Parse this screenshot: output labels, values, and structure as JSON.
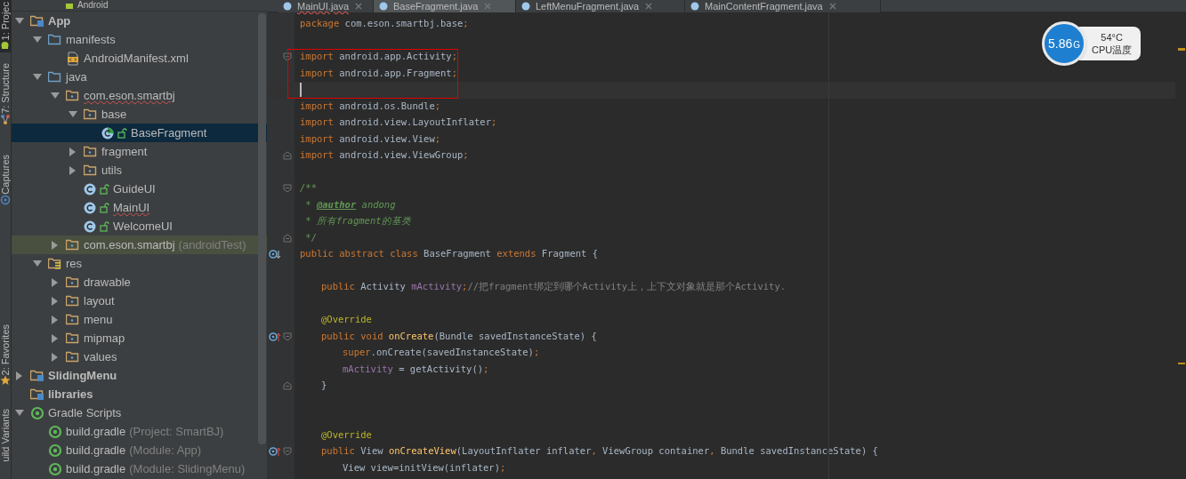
{
  "tool_strip": [
    {
      "label": "1: Projec",
      "selected": true
    },
    {
      "label": "7: Structure",
      "selected": false
    },
    {
      "label": "Captures",
      "selected": false
    },
    {
      "label": "2: Favorites",
      "selected": false
    },
    {
      "label": "uild Variants",
      "selected": false
    }
  ],
  "project_panel": {
    "view": "Android",
    "tree": [
      {
        "label": "App",
        "kind": "module",
        "expanded": true,
        "children": [
          {
            "label": "manifests",
            "kind": "folder",
            "expanded": true,
            "children": [
              {
                "label": "AndroidManifest.xml",
                "kind": "xml"
              }
            ]
          },
          {
            "label": "java",
            "kind": "folder",
            "expanded": true,
            "children": [
              {
                "label": "com.eson.smartbj",
                "kind": "package",
                "expanded": true,
                "error": true,
                "children": [
                  {
                    "label": "base",
                    "kind": "package",
                    "expanded": true,
                    "children": [
                      {
                        "label": "BaseFragment",
                        "kind": "abstract-class",
                        "selected": true
                      }
                    ]
                  },
                  {
                    "label": "fragment",
                    "kind": "package",
                    "expanded": false
                  },
                  {
                    "label": "utils",
                    "kind": "package",
                    "expanded": false
                  },
                  {
                    "label": "GuideUI",
                    "kind": "class"
                  },
                  {
                    "label": "MainUI",
                    "kind": "class",
                    "error": true
                  },
                  {
                    "label": "WelcomeUI",
                    "kind": "class"
                  }
                ]
              },
              {
                "label": "com.eson.smartbj",
                "suffix": "(androidTest)",
                "kind": "package",
                "expanded": false,
                "highlighted": true
              }
            ]
          },
          {
            "label": "res",
            "kind": "res",
            "expanded": true,
            "children": [
              {
                "label": "drawable",
                "kind": "package",
                "expanded": false
              },
              {
                "label": "layout",
                "kind": "package",
                "expanded": false
              },
              {
                "label": "menu",
                "kind": "package",
                "expanded": false
              },
              {
                "label": "mipmap",
                "kind": "package",
                "expanded": false
              },
              {
                "label": "values",
                "kind": "package",
                "expanded": false
              }
            ]
          }
        ]
      },
      {
        "label": "SlidingMenu",
        "kind": "module",
        "expanded": false
      },
      {
        "label": "libraries",
        "kind": "module"
      },
      {
        "label": "Gradle Scripts",
        "kind": "gradle",
        "expanded": true,
        "children": [
          {
            "label": "build.gradle",
            "suffix": "(Project: SmartBJ)",
            "kind": "gradle"
          },
          {
            "label": "build.gradle",
            "suffix": "(Module: App)",
            "kind": "gradle"
          },
          {
            "label": "build.gradle",
            "suffix": "(Module: SlidingMenu)",
            "kind": "gradle"
          }
        ]
      }
    ]
  },
  "editor_tabs": [
    {
      "label": "MainUI.java",
      "selected": false,
      "error": true
    },
    {
      "label": "BaseFragment.java",
      "selected": true,
      "error": false
    },
    {
      "label": "LeftMenuFragment.java",
      "selected": false,
      "error": false
    },
    {
      "label": "MainContentFragment.java",
      "selected": false,
      "error": false
    }
  ],
  "code_lines": [
    {
      "tokens": [
        {
          "kind": "keyword",
          "text": "package "
        },
        {
          "kind": "plain",
          "text": "com.eson.smartbj.base"
        },
        {
          "kind": "keyword",
          "text": ";"
        }
      ]
    },
    {
      "kind": "blank"
    },
    {
      "fold_open": true,
      "boxed": true,
      "tokens": [
        {
          "kind": "keyword",
          "text": "import "
        },
        {
          "kind": "plain",
          "text": "android.app.Activity"
        },
        {
          "kind": "keyword",
          "text": ";"
        }
      ]
    },
    {
      "boxed": true,
      "tokens": [
        {
          "kind": "keyword",
          "text": "import "
        },
        {
          "kind": "plain",
          "text": "android.app.Fragment"
        },
        {
          "kind": "keyword",
          "text": ";"
        }
      ]
    },
    {
      "kind": "blank",
      "boxed": true,
      "caret": true
    },
    {
      "tokens": [
        {
          "kind": "keyword",
          "text": "import "
        },
        {
          "kind": "plain",
          "text": "android.os.Bundle"
        },
        {
          "kind": "keyword",
          "text": ";"
        }
      ]
    },
    {
      "tokens": [
        {
          "kind": "keyword",
          "text": "import "
        },
        {
          "kind": "plain",
          "text": "android.view.LayoutInflater"
        },
        {
          "kind": "keyword",
          "text": ";"
        }
      ]
    },
    {
      "tokens": [
        {
          "kind": "keyword",
          "text": "import "
        },
        {
          "kind": "plain",
          "text": "android.view.View"
        },
        {
          "kind": "keyword",
          "text": ";"
        }
      ]
    },
    {
      "fold_close": true,
      "tokens": [
        {
          "kind": "keyword",
          "text": "import "
        },
        {
          "kind": "plain",
          "text": "android.view.ViewGroup"
        },
        {
          "kind": "keyword",
          "text": ";"
        }
      ]
    },
    {
      "kind": "blank"
    },
    {
      "fold_open": true,
      "tokens": [
        {
          "kind": "doc",
          "text": "/**"
        }
      ]
    },
    {
      "tokens": [
        {
          "kind": "doc",
          "text": " * "
        },
        {
          "kind": "doctag",
          "text": "@author"
        },
        {
          "kind": "doc",
          "text": " andong"
        }
      ]
    },
    {
      "tokens": [
        {
          "kind": "doc",
          "text": " * 所有fragment的基类"
        }
      ]
    },
    {
      "fold_close": true,
      "tokens": [
        {
          "kind": "doc",
          "text": " */"
        }
      ]
    },
    {
      "implemented_marker": true,
      "tokens": [
        {
          "kind": "keyword",
          "text": "public abstract class "
        },
        {
          "kind": "plain",
          "text": "BaseFragment "
        },
        {
          "kind": "keyword",
          "text": "extends "
        },
        {
          "kind": "plain",
          "text": "Fragment {"
        }
      ],
      "children": [
        {
          "kind": "blank"
        },
        {
          "tokens": [
            {
              "kind": "keyword",
              "text": "public "
            },
            {
              "kind": "plain",
              "text": "Activity "
            },
            {
              "kind": "field",
              "text": "mActivity"
            },
            {
              "kind": "keyword",
              "text": ";"
            },
            {
              "kind": "comment",
              "text": "//把fragment绑定到哪个Activity上，上下文对象就是那个Activity."
            }
          ]
        },
        {
          "kind": "blank"
        },
        {
          "tokens": [
            {
              "kind": "annotation",
              "text": "@Override"
            }
          ]
        },
        {
          "override_marker": true,
          "fold_open": true,
          "tokens": [
            {
              "kind": "keyword",
              "text": "public void "
            },
            {
              "kind": "method",
              "text": "onCreate"
            },
            {
              "kind": "plain",
              "text": "(Bundle savedInstanceState) {"
            }
          ],
          "children": [
            {
              "tokens": [
                {
                  "kind": "keyword",
                  "text": "super"
                },
                {
                  "kind": "plain",
                  "text": ".onCreate(savedInstanceState)"
                },
                {
                  "kind": "keyword",
                  "text": ";"
                }
              ]
            },
            {
              "tokens": [
                {
                  "kind": "field",
                  "text": "mActivity"
                },
                {
                  "kind": "plain",
                  "text": " = getActivity()"
                },
                {
                  "kind": "keyword",
                  "text": ";"
                }
              ]
            }
          ]
        },
        {
          "fold_close": true,
          "tokens": [
            {
              "kind": "plain",
              "text": "}"
            }
          ]
        },
        {
          "kind": "blank"
        },
        {
          "kind": "blank"
        },
        {
          "tokens": [
            {
              "kind": "annotation",
              "text": "@Override"
            }
          ]
        },
        {
          "override_marker": true,
          "fold_open": true,
          "tokens": [
            {
              "kind": "keyword",
              "text": "public "
            },
            {
              "kind": "plain",
              "text": "View "
            },
            {
              "kind": "method",
              "text": "onCreateView"
            },
            {
              "kind": "plain",
              "text": "(LayoutInflater inflater"
            },
            {
              "kind": "keyword",
              "text": ", "
            },
            {
              "kind": "plain",
              "text": "ViewGroup container"
            },
            {
              "kind": "keyword",
              "text": ", "
            },
            {
              "kind": "plain",
              "text": "Bundle savedInstanceState) {"
            }
          ],
          "children": [
            {
              "tokens": [
                {
                  "kind": "plain",
                  "text": "View view=initView(inflater)"
                },
                {
                  "kind": "keyword",
                  "text": ";"
                }
              ]
            }
          ]
        }
      ]
    }
  ],
  "cpu_widget": {
    "value": "5.86",
    "unit": "G",
    "temperature": "54°C",
    "label": "CPU温度"
  }
}
